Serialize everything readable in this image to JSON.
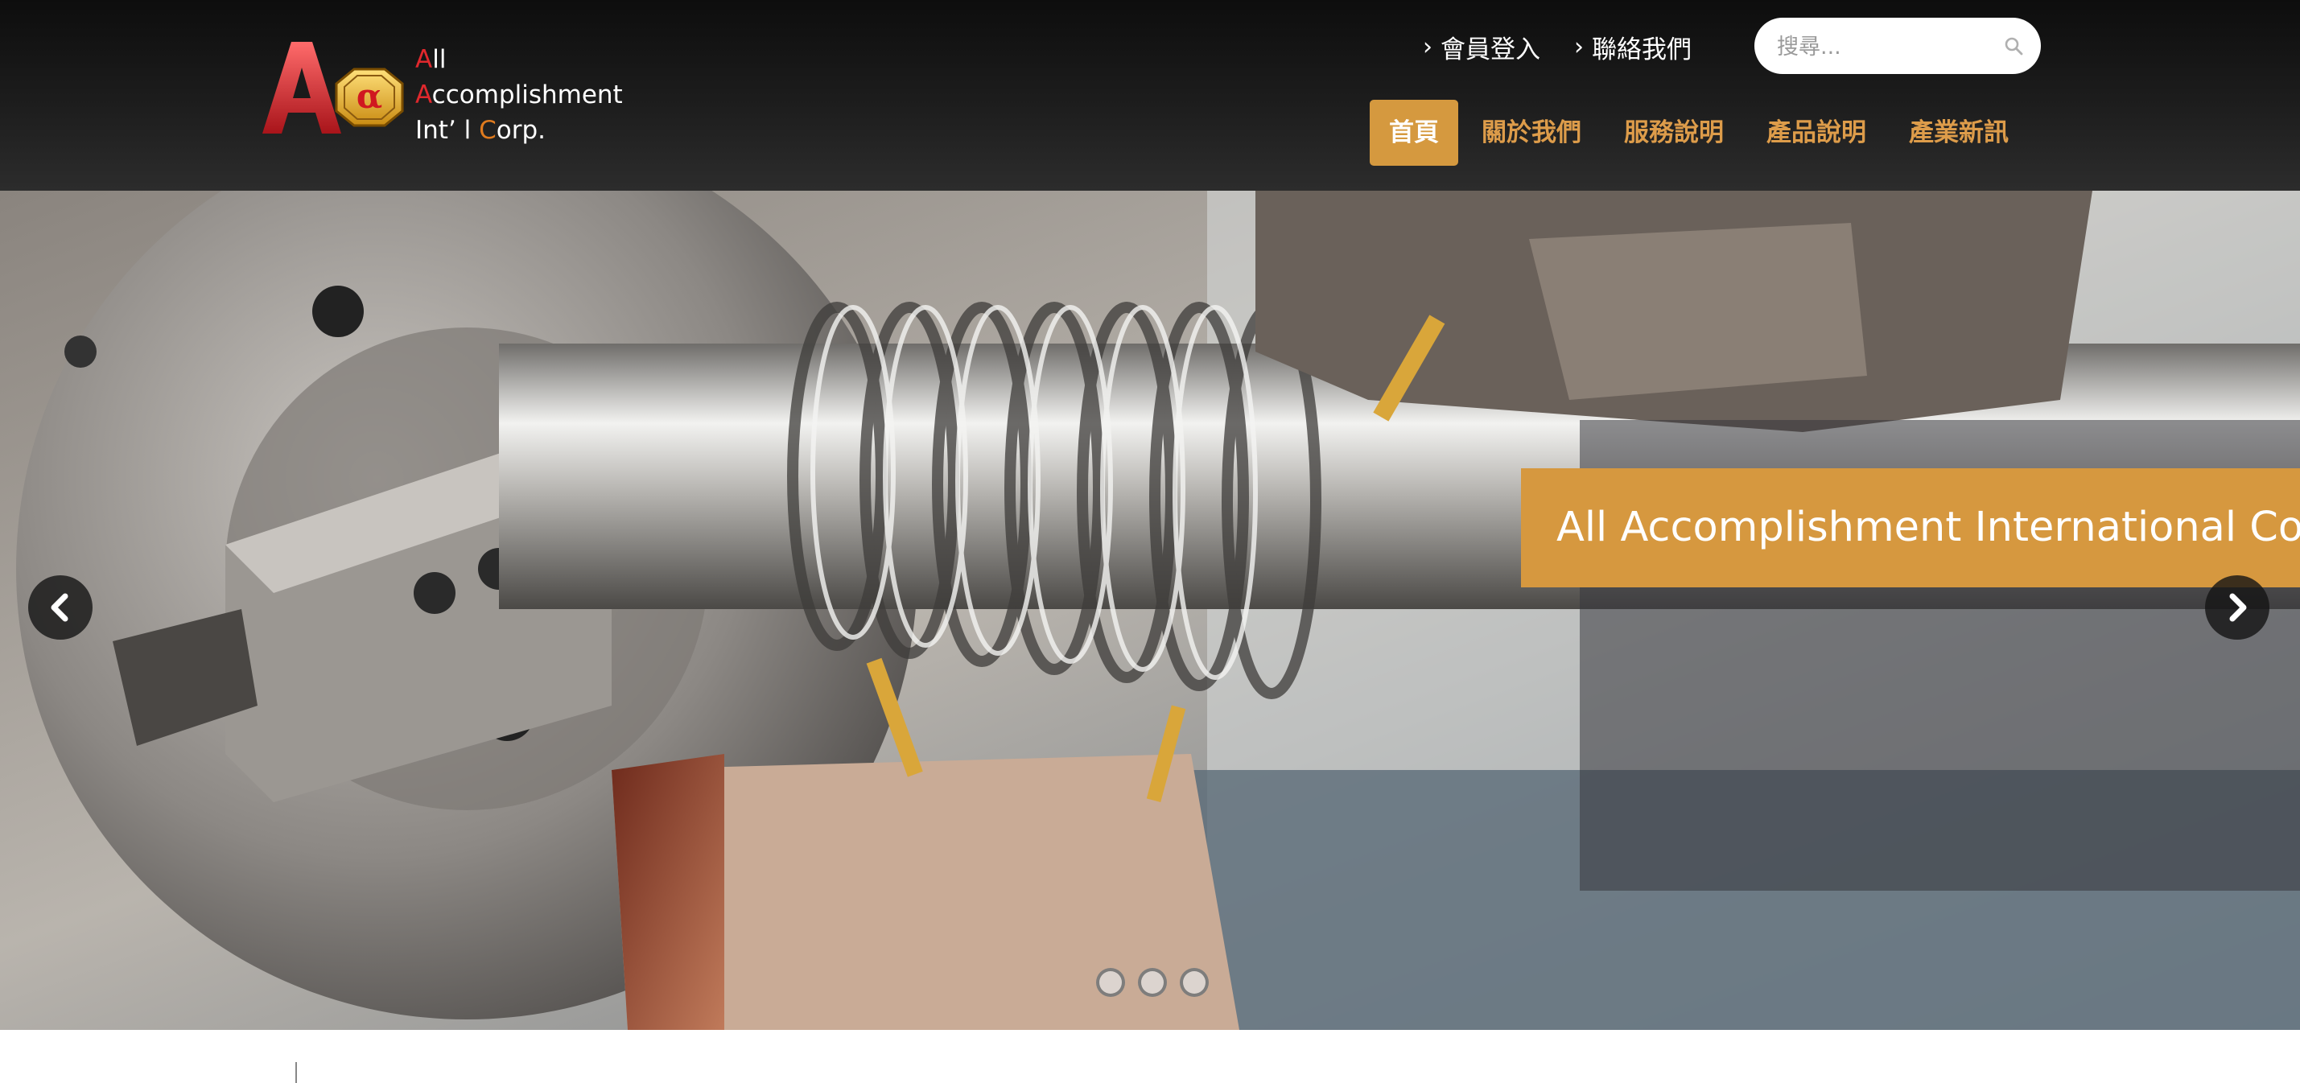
{
  "logo": {
    "line1_hl": "A",
    "line1_rest": "ll",
    "line2_hl": "A",
    "line2_rest": "ccomplishment",
    "line3_a": "Int’ l ",
    "line3_hl": "C",
    "line3_rest": "orp.",
    "mark_letter": "A",
    "mark_symbol": "α"
  },
  "top_links": [
    {
      "label": "會員登入",
      "icon": "chevron-right-icon"
    },
    {
      "label": "聯絡我們",
      "icon": "chevron-right-icon"
    }
  ],
  "search": {
    "placeholder": "搜尋...",
    "icon": "search-icon"
  },
  "nav": [
    {
      "label": "首頁",
      "active": true
    },
    {
      "label": "關於我們"
    },
    {
      "label": "服務說明"
    },
    {
      "label": "產品說明"
    },
    {
      "label": "產業新訊"
    }
  ],
  "hero": {
    "caption": "All Accomplishment International Corp.",
    "prev_icon": "chevron-left-icon",
    "next_icon": "chevron-right-icon",
    "slides": 3,
    "active_slide": 1
  },
  "colors": {
    "accent": "#d5993f",
    "logo_red": "#e0282d",
    "logo_orange": "#e07b1e",
    "header_bg": "#1a1a1a"
  }
}
